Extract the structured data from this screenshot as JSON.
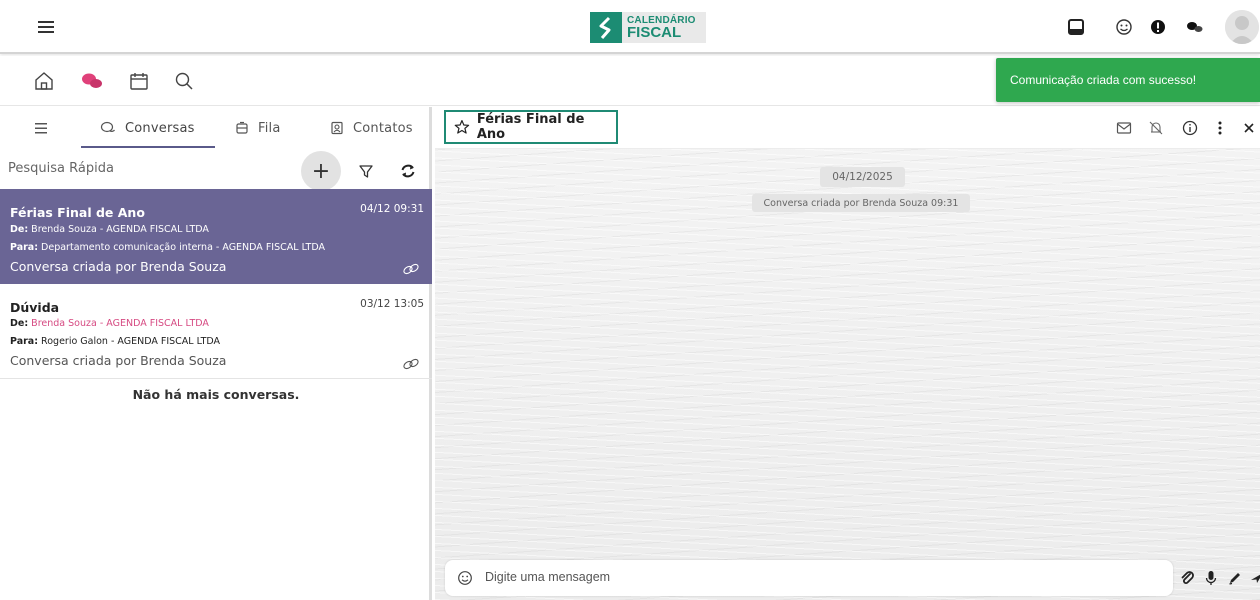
{
  "header": {
    "logo_line1": "CALENDÁRIO",
    "logo_line2": "FISCAL",
    "brand_color": "#1c8c73",
    "icons": [
      "menu-icon",
      "inbox-icon",
      "smiley-icon",
      "alert-icon",
      "chat-bubbles-icon",
      "avatar"
    ]
  },
  "subnav": {
    "icons": [
      "home-icon",
      "chat-icon",
      "calendar-icon",
      "search-icon"
    ],
    "active_color": "#e0417a"
  },
  "toast": {
    "message": "Comunicação criada com sucesso!",
    "color": "#2fa84f"
  },
  "left_panel": {
    "tabs": [
      {
        "label": "Conversas",
        "icon": "chat-outline-icon",
        "active": true
      },
      {
        "label": "Fila",
        "icon": "queue-icon",
        "active": false
      },
      {
        "label": "Contatos",
        "icon": "contacts-icon",
        "active": false
      }
    ],
    "search_placeholder": "Pesquisa Rápida",
    "add_label": "+",
    "conversations": [
      {
        "title": "Férias Final de Ano",
        "date": "04/12 09:31",
        "from_label": "De:",
        "from": "Brenda Souza - AGENDA FISCAL LTDA",
        "to_label": "Para:",
        "to": "Departamento comunicação interna - AGENDA FISCAL LTDA",
        "subtitle": "Conversa criada por Brenda Souza",
        "selected": true
      },
      {
        "title": "Dúvida",
        "date": "03/12 13:05",
        "from_label": "De:",
        "from": "Brenda Souza - AGENDA FISCAL LTDA",
        "to_label": "Para:",
        "to": "Rogerio Galon - AGENDA FISCAL LTDA",
        "subtitle": "Conversa criada por Brenda Souza",
        "selected": false
      }
    ],
    "no_more": "Não há mais conversas.",
    "selected_color": "#6a6595"
  },
  "chat": {
    "title": "Férias Final de Ano",
    "header_icons": [
      "mail-icon",
      "notifications-off-icon",
      "info-icon",
      "more-vertical-icon",
      "close-icon"
    ],
    "date_separator": "04/12/2025",
    "system_message": "Conversa criada por Brenda Souza 09:31",
    "composer_placeholder": "Digite uma mensagem",
    "composer_icons": [
      "attach-icon",
      "microphone-icon",
      "pen-icon",
      "send-icon"
    ],
    "accent": "#1f8a74"
  }
}
